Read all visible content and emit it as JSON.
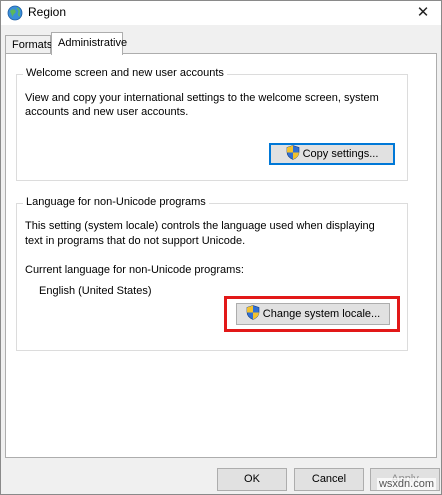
{
  "window": {
    "title": "Region"
  },
  "tabs": [
    {
      "label": "Formats",
      "active": false
    },
    {
      "label": "Administrative",
      "active": true
    }
  ],
  "welcome": {
    "legend": "Welcome screen and new user accounts",
    "description_line1": "View and copy your international settings to the welcome screen, system",
    "description_line2": "accounts and new user accounts.",
    "button": "Copy settings..."
  },
  "unicode": {
    "legend": "Language for non-Unicode programs",
    "description_line1": "This setting (system locale) controls the language used when displaying",
    "description_line2": "text in programs that do not support Unicode.",
    "current_label": "Current language for non-Unicode programs:",
    "current_value": "English (United States)",
    "button": "Change system locale..."
  },
  "footer": {
    "ok": "OK",
    "cancel": "Cancel",
    "apply": "Apply"
  },
  "watermark": "wsxdn.com",
  "colors": {
    "highlight": "#e21818",
    "focus": "#0078d7",
    "shield_blue": "#2f6fd6",
    "shield_yellow": "#f2c12e"
  }
}
